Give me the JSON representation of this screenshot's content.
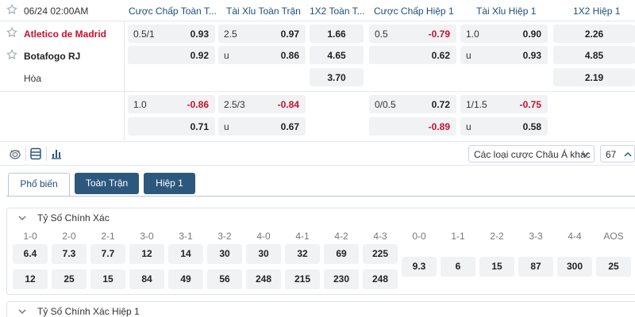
{
  "header": {
    "time": "06/24 02:00AM",
    "markets": [
      "Cược Chấp Toàn T...",
      "Tài Xỉu Toàn Trận",
      "1X2 Toàn T...",
      "Cược Chấp Hiệp 1",
      "Tài Xỉu Hiệp 1",
      "1X2 Hiệp 1"
    ]
  },
  "teams": {
    "home": "Atletico de Madrid",
    "away": "Botafogo RJ",
    "draw": "Hòa"
  },
  "odds": {
    "row1": {
      "hdp_line": "0.5/1",
      "hdp_odd": "0.93",
      "ou_line": "2.5",
      "ou_odd": "0.97",
      "x12": "1.66",
      "h1hdp_line": "0.5",
      "h1hdp_odd": "-0.79",
      "h1ou_line": "1.0",
      "h1ou_odd": "0.90",
      "h1x12": "2.26"
    },
    "row2": {
      "hdp_odd": "0.92",
      "ou_line": "u",
      "ou_odd": "0.86",
      "x12": "4.65",
      "h1hdp_odd": "0.62",
      "h1ou_line": "u",
      "h1ou_odd": "0.93",
      "h1x12": "4.85"
    },
    "row3": {
      "x12": "3.70",
      "h1x12": "2.19"
    },
    "row4": {
      "hdp_line": "1.0",
      "hdp_odd": "-0.86",
      "ou_line": "2.5/3",
      "ou_odd": "-0.84",
      "h1hdp_line": "0/0.5",
      "h1hdp_odd": "0.72",
      "h1ou_line": "1/1.5",
      "h1ou_odd": "-0.75"
    },
    "row5": {
      "hdp_odd": "0.71",
      "ou_line": "u",
      "ou_odd": "0.67",
      "h1hdp_odd": "-0.89",
      "h1ou_line": "u",
      "h1ou_odd": "0.58"
    }
  },
  "toolbar": {
    "odds_type": "Các loại cược Châu Á khác",
    "count": "67"
  },
  "tabs": {
    "popular": "Phổ biến",
    "full": "Toàn Trận",
    "half1": "Hiệp 1"
  },
  "correct_score": {
    "title": "Tỷ Số Chính Xác",
    "headers": [
      "1-0",
      "2-0",
      "2-1",
      "3-0",
      "3-1",
      "3-2",
      "4-0",
      "4-1",
      "4-2",
      "4-3",
      "0-0",
      "1-1",
      "2-2",
      "3-3",
      "4-4",
      "AOS"
    ],
    "home_row": [
      "6.4",
      "7.3",
      "7.7",
      "12",
      "14",
      "30",
      "30",
      "32",
      "69",
      "225"
    ],
    "away_row": [
      "12",
      "25",
      "15",
      "84",
      "49",
      "56",
      "248",
      "215",
      "230",
      "248"
    ],
    "draw_row": [
      "9.3",
      "6",
      "15",
      "87",
      "300",
      "25"
    ]
  },
  "correct_score_h1": {
    "title": "Tỷ Số Chính Xác Hiệp 1"
  },
  "colors": {
    "negative": "#c8102e",
    "tab_dark": "#2c587e",
    "header_text": "#1f4d7a"
  }
}
